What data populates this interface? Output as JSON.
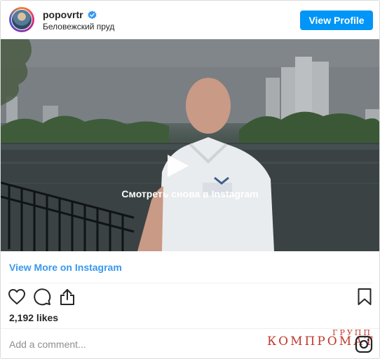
{
  "header": {
    "username": "popovrtr",
    "verified_icon": "verified-badge-icon",
    "location": "Беловежский пруд",
    "view_profile_label": "View Profile"
  },
  "media": {
    "overlay_text": "Смотреть снова в Instagram",
    "play_icon": "play-icon"
  },
  "post": {
    "view_more_label": "View More on Instagram",
    "likes": "2,192 likes"
  },
  "actions": {
    "icons": [
      "heart-icon",
      "comment-icon",
      "share-icon",
      "bookmark-icon"
    ]
  },
  "comment": {
    "placeholder": "Add a comment..."
  },
  "watermark": {
    "small": "ГРУПП",
    "main": "КОМПРОМАТ"
  },
  "colors": {
    "accent": "#0095f6",
    "link": "#3897f0",
    "text": "#262626",
    "muted": "#8e8e8e",
    "watermark": "#c0392b"
  }
}
